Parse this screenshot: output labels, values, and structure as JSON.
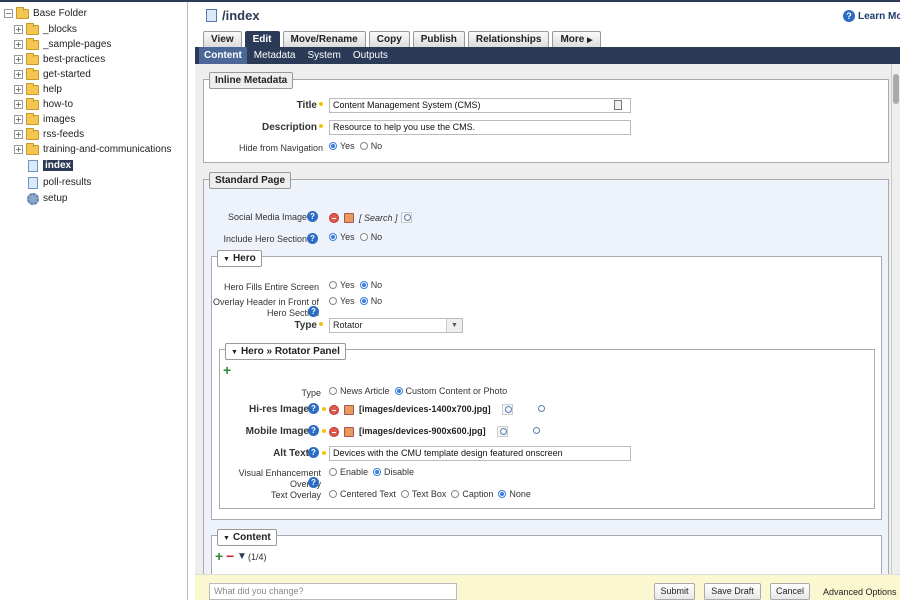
{
  "sidebar": {
    "root": "Base Folder",
    "items": [
      {
        "label": "_blocks",
        "type": "folder"
      },
      {
        "label": "_sample-pages",
        "type": "folder"
      },
      {
        "label": "best-practices",
        "type": "folder"
      },
      {
        "label": "get-started",
        "type": "folder"
      },
      {
        "label": "help",
        "type": "folder"
      },
      {
        "label": "how-to",
        "type": "folder"
      },
      {
        "label": "images",
        "type": "folder"
      },
      {
        "label": "rss-feeds",
        "type": "folder"
      },
      {
        "label": "training-and-communications",
        "type": "folder"
      },
      {
        "label": "index",
        "type": "page",
        "active": true
      },
      {
        "label": "poll-results",
        "type": "page"
      },
      {
        "label": "setup",
        "type": "config"
      }
    ]
  },
  "header": {
    "path": "/index",
    "learn_more": "Learn Mo"
  },
  "tabs": [
    "View",
    "Edit",
    "Move/Rename",
    "Copy",
    "Publish",
    "Relationships",
    "More"
  ],
  "active_tab": "Edit",
  "subtabs": [
    "Content",
    "Metadata",
    "System",
    "Outputs"
  ],
  "active_subtab": "Content",
  "inline_metadata": {
    "legend": "Inline Metadata",
    "title_label": "Title",
    "title_value": "Content Management System (CMS)",
    "desc_label": "Description",
    "desc_value": "Resource to help you use the CMS.",
    "hide_label": "Hide from Navigation",
    "yes": "Yes",
    "no": "No"
  },
  "standard_page": {
    "legend": "Standard Page",
    "social_label": "Social Media Image",
    "search_text": "[ Search ]",
    "hero_include_label": "Include Hero Section",
    "yes": "Yes",
    "no": "No"
  },
  "hero": {
    "legend": "Hero",
    "fills_label": "Hero Fills Entire Screen",
    "overlay_label_1": "Overlay Header in Front of",
    "overlay_label_2": "Hero Section",
    "type_label": "Type",
    "type_value": "Rotator",
    "yes": "Yes",
    "no": "No"
  },
  "rotator": {
    "legend": "Hero » Rotator Panel",
    "type_label": "Type",
    "type_opt1": "News Article",
    "type_opt2": "Custom Content or Photo",
    "hires_label": "Hi-res Image",
    "hires_path": "[images/devices-1400x700.jpg]",
    "mobile_label": "Mobile Image",
    "mobile_path": "[images/devices-900x600.jpg]",
    "alt_label": "Alt Text",
    "alt_value": "Devices with the CMU template design featured onscreen",
    "visual_label_1": "Visual Enhancement",
    "visual_label_2": "Overlay",
    "enable": "Enable",
    "disable": "Disable",
    "text_overlay_label": "Text Overlay",
    "to_opt1": "Centered Text",
    "to_opt2": "Text Box",
    "to_opt3": "Caption",
    "to_opt4": "None"
  },
  "content_block": {
    "legend": "Content",
    "counter": "(1/4)"
  },
  "bottom": {
    "comment_placeholder": "What did you change?",
    "submit": "Submit",
    "save_draft": "Save Draft",
    "cancel": "Cancel",
    "advanced": "Advanced Options"
  }
}
